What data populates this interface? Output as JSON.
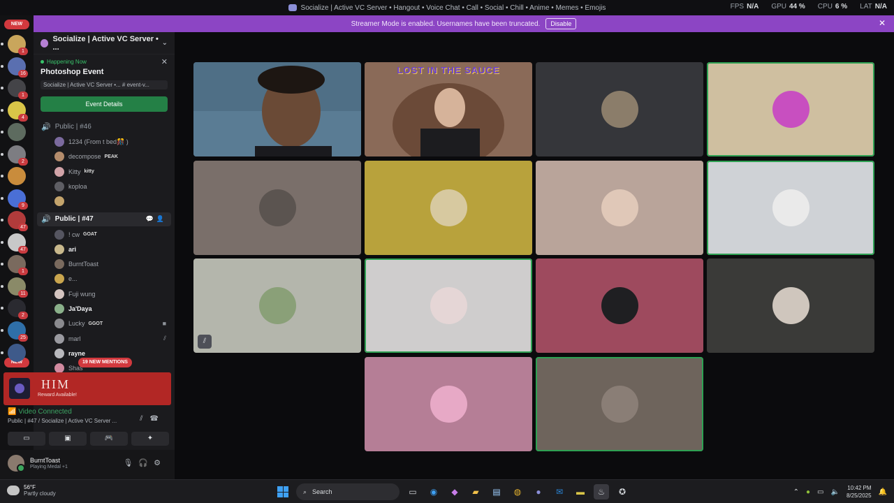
{
  "window": {
    "title": "Socialize | Active VC Server • Hangout • Voice Chat • Call • Social • Chill • Anime • Memes • Emojis",
    "perf": [
      {
        "label": "FPS",
        "value": "N/A"
      },
      {
        "label": "GPU",
        "value": "44 %"
      },
      {
        "label": "CPU",
        "value": "6 %"
      },
      {
        "label": "LAT",
        "value": "N/A"
      }
    ]
  },
  "banner": {
    "text": "Streamer Mode is enabled. Usernames have been truncated.",
    "button": "Disable",
    "close_icon": "close-icon"
  },
  "server_rail": {
    "new_top": "NEW",
    "new_bottom": "NEW",
    "servers": [
      {
        "badge": "1",
        "color": "#c9a65c"
      },
      {
        "badge": "16",
        "color": "#5a6fb0"
      },
      {
        "badge": "1",
        "color": "#444448"
      },
      {
        "badge": "4",
        "color": "#d9c548"
      },
      {
        "badge": "",
        "color": "#5d6b5f"
      },
      {
        "badge": "2",
        "color": "#7d7d82"
      },
      {
        "badge": "",
        "color": "#c98c3c"
      },
      {
        "badge": "9",
        "color": "#4a6fd6"
      },
      {
        "badge": "47",
        "color": "#b13b3b"
      },
      {
        "badge": "47",
        "color": "#c8c8c8"
      },
      {
        "badge": "1",
        "color": "#7a6a5e"
      },
      {
        "badge": "11",
        "color": "#8a8a68"
      },
      {
        "badge": "2",
        "color": "#2a2a30"
      },
      {
        "badge": "25",
        "color": "#2f6fa8"
      },
      {
        "badge": "",
        "color": "#3e5a8a"
      }
    ]
  },
  "sidebar": {
    "server_name": "Socialize | Active VC Server • ...",
    "event": {
      "status": "Happening Now",
      "title": "Photoshop Event",
      "location": "Socialize | Active VC Server •... # event-v...",
      "button": "Event Details"
    },
    "channels": [
      {
        "name": "Public | #46",
        "members": [
          {
            "name": "1234 (From t bed🎊 )",
            "tag": "",
            "avatar": "#7b6a9e"
          },
          {
            "name": "decompose",
            "tag": "PEAK",
            "avatar": "#b48c6c"
          },
          {
            "name": "Kitty",
            "tag": "kitty",
            "avatar": "#d1a3a8"
          },
          {
            "name": "koploa",
            "tag": "",
            "avatar": "#5e5e64"
          },
          {
            "name": "",
            "tag": "",
            "avatar": "#c4a46c"
          }
        ]
      },
      {
        "name": "Public | #47",
        "members": [
          {
            "name": "! cw",
            "tag": "GOAT",
            "avatar": "#555560",
            "bold": false
          },
          {
            "name": "ari",
            "tag": "",
            "avatar": "#c8b88c",
            "bold": true
          },
          {
            "name": "BurntToast",
            "tag": "",
            "avatar": "#7a6a5e",
            "bold": false
          },
          {
            "name": "e...",
            "tag": "",
            "avatar": "#c9a54e",
            "bold": false
          },
          {
            "name": "Fuji wung",
            "tag": "",
            "avatar": "#d4c4c0",
            "bold": false
          },
          {
            "name": "Ja'Daya",
            "tag": "",
            "avatar": "#8ab08a",
            "bold": true
          },
          {
            "name": "Lucky",
            "tag": "GGOT",
            "avatar": "#8a8a8e",
            "bold": false
          },
          {
            "name": "marl",
            "tag": "",
            "avatar": "#9a9aa0",
            "bold": false
          },
          {
            "name": "rayne",
            "tag": "",
            "avatar": "#b8b8bc",
            "bold": true
          },
          {
            "name": "Shas",
            "tag": "",
            "avatar": "#d28aa0",
            "bold": false
          }
        ]
      }
    ],
    "new_mentions": "19 NEW MENTIONS",
    "reward": {
      "brand": "HIM",
      "text": "Reward Available!"
    },
    "voice": {
      "status": "Video Connected",
      "path": "Public | #47 / Socialize | Active VC Server ..."
    },
    "user": {
      "name": "BurntToast",
      "activity": "Playing Medal +1"
    }
  },
  "stage": {
    "camera_caption": "LOST IN THE SAUCE",
    "tiles": [
      {
        "bg": "#35363a",
        "avatar": "#8b7d6a",
        "speaking": false
      },
      {
        "bg": "#cfbfa0",
        "avatar": "#c84fc0",
        "speaking": true
      },
      {
        "bg": "#7a6f6a",
        "avatar": "#5b5450",
        "speaking": false
      },
      {
        "bg": "#b8a23c",
        "avatar": "#d7c9a0",
        "speaking": false
      },
      {
        "bg": "#b9a49a",
        "avatar": "#e0c8b8",
        "speaking": false
      },
      {
        "bg": "#cfd2d6",
        "avatar": "#eaeaea",
        "speaking": true
      },
      {
        "bg": "#b4b6ac",
        "avatar": "#8aa078",
        "speaking": false,
        "muted": true
      },
      {
        "bg": "#cfcdcd",
        "avatar": "#e5d6d6",
        "speaking": true
      },
      {
        "bg": "#9e4a5e",
        "avatar": "#1f1f22",
        "speaking": false
      },
      {
        "bg": "#3a3a38",
        "avatar": "#cfc6bd",
        "speaking": false
      },
      {
        "bg": "#b57e96",
        "avatar": "#e7a9c6",
        "speaking": false
      },
      {
        "bg": "#6e645c",
        "avatar": "#8a7e76",
        "speaking": true
      }
    ]
  },
  "taskbar": {
    "weather_temp": "56°F",
    "weather_cond": "Partly cloudy",
    "search": "Search",
    "time": "10:42 PM",
    "date": "8/25/2025"
  }
}
